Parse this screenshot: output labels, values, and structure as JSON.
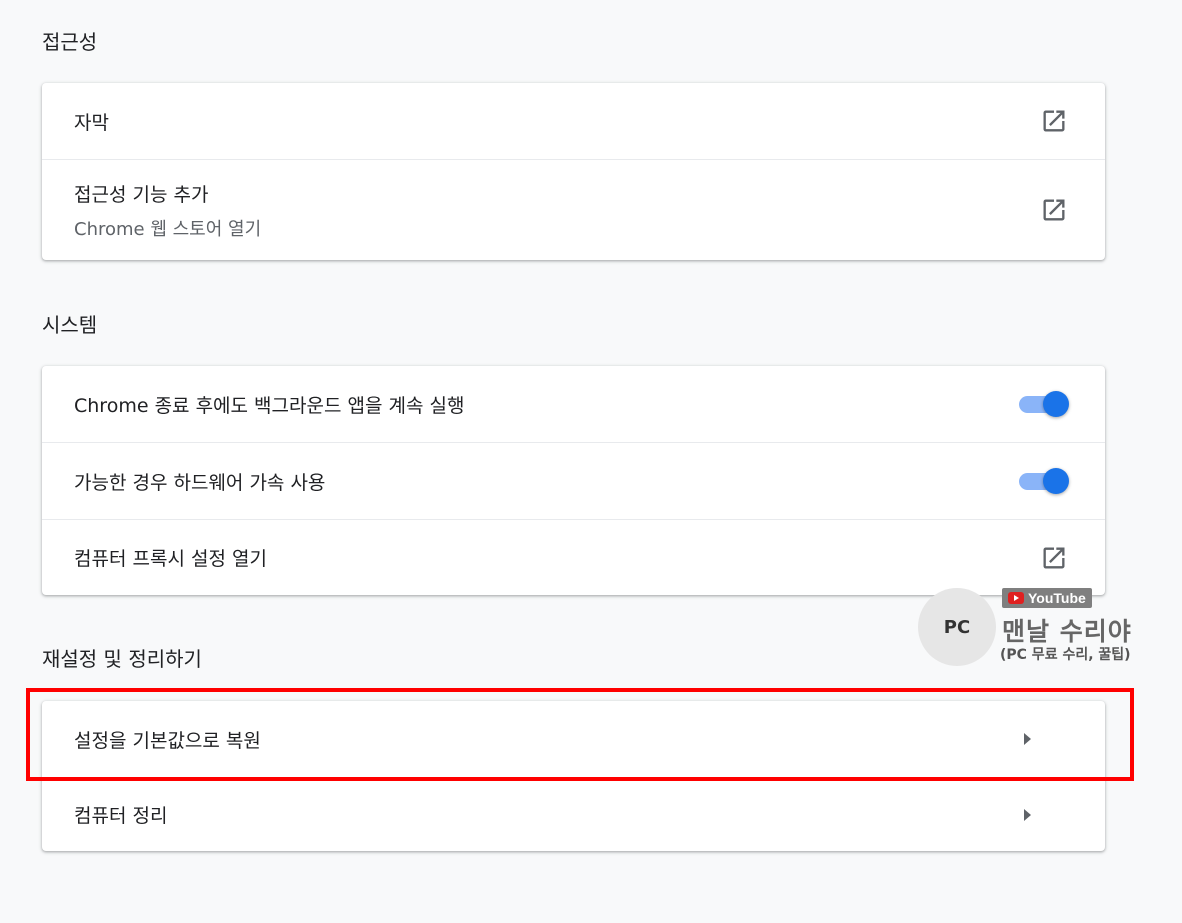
{
  "sections": {
    "accessibility": {
      "title": "접근성",
      "captions_label": "자막",
      "add_features_label": "접근성 기능 추가",
      "add_features_sublabel": "Chrome 웹 스토어 열기"
    },
    "system": {
      "title": "시스템",
      "background_apps_label": "Chrome 종료 후에도 백그라운드 앱을 계속 실행",
      "background_apps_enabled": true,
      "hardware_accel_label": "가능한 경우 하드웨어 가속 사용",
      "hardware_accel_enabled": true,
      "proxy_label": "컴퓨터 프록시 설정 열기"
    },
    "reset": {
      "title": "재설정 및 정리하기",
      "restore_label": "설정을 기본값으로 복원",
      "cleanup_label": "컴퓨터 정리"
    }
  },
  "watermark": {
    "badge": "PC",
    "youtube": "YouTube",
    "name": "맨날 수리야",
    "subtitle": "(PC 무료 수리, 꿀팁)"
  },
  "colors": {
    "background": "#f8f9fa",
    "toggle_on": "#1a73e8",
    "toggle_track": "#8ab4f8",
    "highlight": "#ff0000"
  },
  "icons": {
    "external_link": "open-in-new-icon",
    "submenu_arrow": "arrow-right-icon"
  }
}
